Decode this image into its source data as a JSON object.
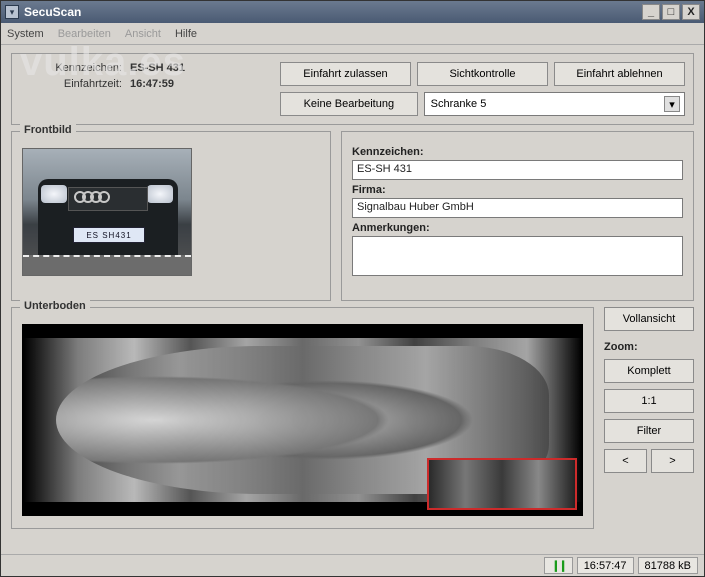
{
  "window": {
    "title": "SecuScan",
    "btn_min": "_",
    "btn_max": "□",
    "btn_close": "X"
  },
  "menu": {
    "items": [
      "System",
      "Bearbeiten",
      "Ansicht",
      "Hilfe"
    ]
  },
  "info": {
    "kennzeichen_label": "Kennzeichen:",
    "kennzeichen_value": "ES-SH 431",
    "einfahrtzeit_label": "Einfahrtzeit:",
    "einfahrtzeit_value": "16:47:59"
  },
  "actions": {
    "einfahrt_zulassen": "Einfahrt zulassen",
    "sichtkontrolle": "Sichtkontrolle",
    "einfahrt_ablehnen": "Einfahrt ablehnen",
    "keine_bearbeitung": "Keine Bearbeitung",
    "schranke_selected": "Schranke 5"
  },
  "frontbild": {
    "title": "Frontbild",
    "plate_text": "ES SH431"
  },
  "details": {
    "kennzeichen_label": "Kennzeichen:",
    "kennzeichen_value": "ES-SH 431",
    "firma_label": "Firma:",
    "firma_value": "Signalbau Huber GmbH",
    "anmerkungen_label": "Anmerkungen:",
    "anmerkungen_value": ""
  },
  "unterboden": {
    "title": "Unterboden"
  },
  "right": {
    "vollansicht": "Vollansicht",
    "zoom_label": "Zoom:",
    "komplett": "Komplett",
    "one_to_one": "1:1",
    "filter": "Filter",
    "prev": "<",
    "next": ">"
  },
  "status": {
    "pause_icon": "❙❙",
    "time": "16:57:47",
    "mem": "81788 kB"
  },
  "watermark": "vulka.es"
}
